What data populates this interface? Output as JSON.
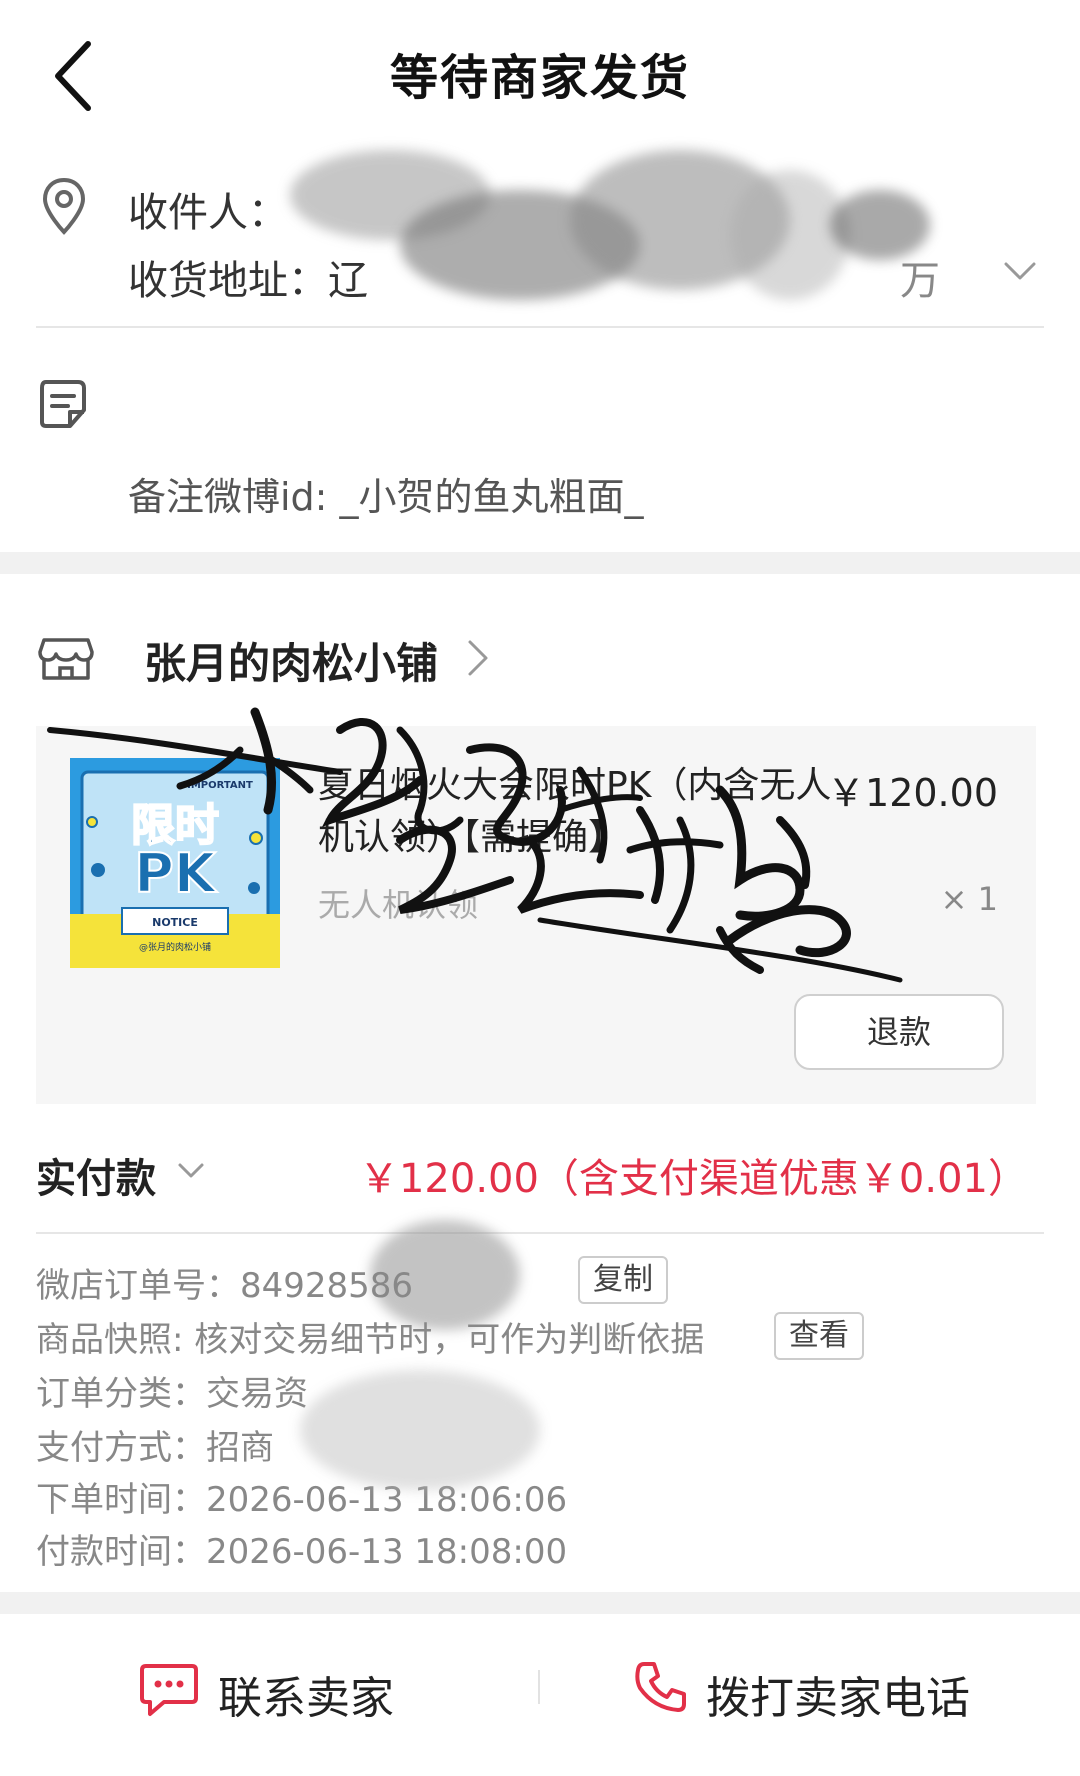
{
  "header": {
    "title": "等待商家发货"
  },
  "address": {
    "recipient_label": "收件人：",
    "address_label": "收货地址：",
    "address_visible": "辽",
    "address_tail": "万"
  },
  "note": {
    "text": "备注微博id: _小贺的鱼丸粗面_"
  },
  "shop": {
    "name": "张月的肉松小铺"
  },
  "product": {
    "title": "夏日烟火大会限时PK（内含无人机认领）【需提确】",
    "price": "￥120.00",
    "spec": "无人机认领",
    "quantity": "× 1",
    "refund_label": "退款",
    "image_texts": {
      "top": "IMPORTANT",
      "main_1": "限时",
      "main_2": "PK",
      "notice": "NOTICE",
      "credit": "@张月的肉松小铺"
    }
  },
  "signature": {
    "text": "小贺的鱼丸粗面"
  },
  "payment": {
    "label": "实付款",
    "amount": "￥120.00（含支付渠道优惠￥0.01）"
  },
  "order_info": {
    "order_no": "微店订单号：84928586",
    "copy_label": "复制",
    "snapshot": "商品快照: 核对交易细节时，可作为判断依据",
    "view_label": "查看",
    "category": "订单分类：交易资",
    "pay_method": "支付方式：招商",
    "order_time": "下单时间：2026-06-13 18:06:06",
    "pay_time": "付款时间：2026-06-13 18:08:00"
  },
  "bottom_bar": {
    "contact_label": "联系卖家",
    "call_label": "拨打卖家电话"
  },
  "colors": {
    "accent_red": "#e23048",
    "bg_band": "#f1f1f1",
    "card_bg": "#f6f6f6",
    "image_blue": "#2c9be0",
    "image_yellow": "#f5e33a"
  }
}
